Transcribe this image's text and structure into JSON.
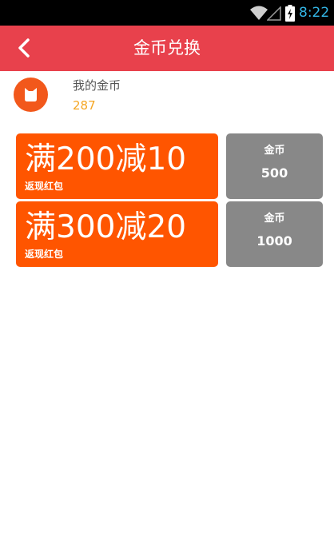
{
  "status_bar": {
    "time": "8:22",
    "icons": [
      "wifi-icon",
      "cell-signal-icon",
      "battery-charging-icon"
    ],
    "time_color": "#33b5e5"
  },
  "header": {
    "title": "金币兑换",
    "back_icon": "chevron-left-icon",
    "background": "#e8414c"
  },
  "wallet": {
    "icon": "coin-avatar-icon",
    "label": "我的金币",
    "balance": "287",
    "balance_color": "#f5a623"
  },
  "coupons": [
    {
      "title": "满200减10",
      "subtitle": "返现红包",
      "cost_label": "金币",
      "cost": "500"
    },
    {
      "title": "满300减20",
      "subtitle": "返现红包",
      "cost_label": "金币",
      "cost": "1000"
    }
  ],
  "colors": {
    "coupon_bg": "#ff5500",
    "cost_bg": "#888888"
  }
}
